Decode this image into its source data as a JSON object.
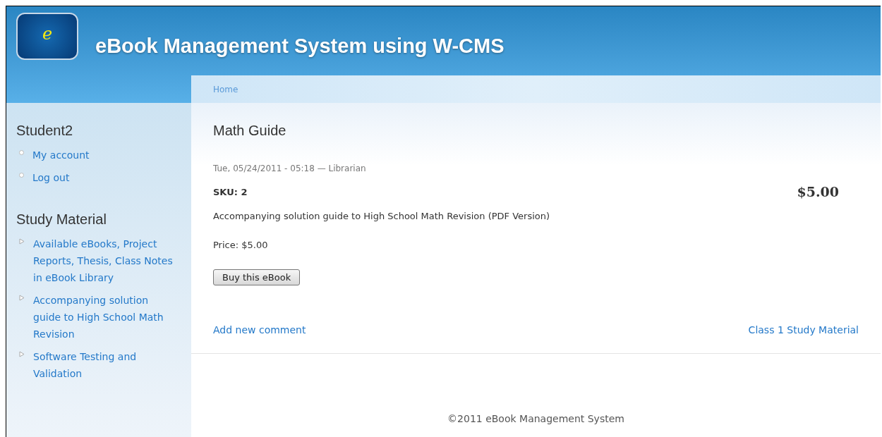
{
  "header": {
    "logo_letter": "e",
    "site_title": "eBook Management System using W-CMS"
  },
  "breadcrumb": [
    "Home"
  ],
  "sidebar": {
    "blocks": [
      {
        "title": "Student2",
        "kind": "user",
        "links": [
          "My account",
          "Log out"
        ]
      },
      {
        "title": "Study Material",
        "kind": "nav",
        "links": [
          "Available eBooks, Project Reports, Thesis, Class Notes in eBook Library",
          "Accompanying solution guide to High School Math Revision",
          "Software Testing and Validation"
        ]
      }
    ]
  },
  "node": {
    "title": "Math Guide",
    "submitted": "Tue, 05/24/2011 - 05:18 — Librarian",
    "sku": "SKU: 2",
    "display_price": "$5.00",
    "body": "Accompanying solution guide to High School Math Revision (PDF Version)",
    "price": "Price: $5.00",
    "button": "Buy this eBook",
    "links": [
      "Add new comment",
      "Class 1 Study Material"
    ]
  },
  "footer": "©2011 eBook Management System"
}
